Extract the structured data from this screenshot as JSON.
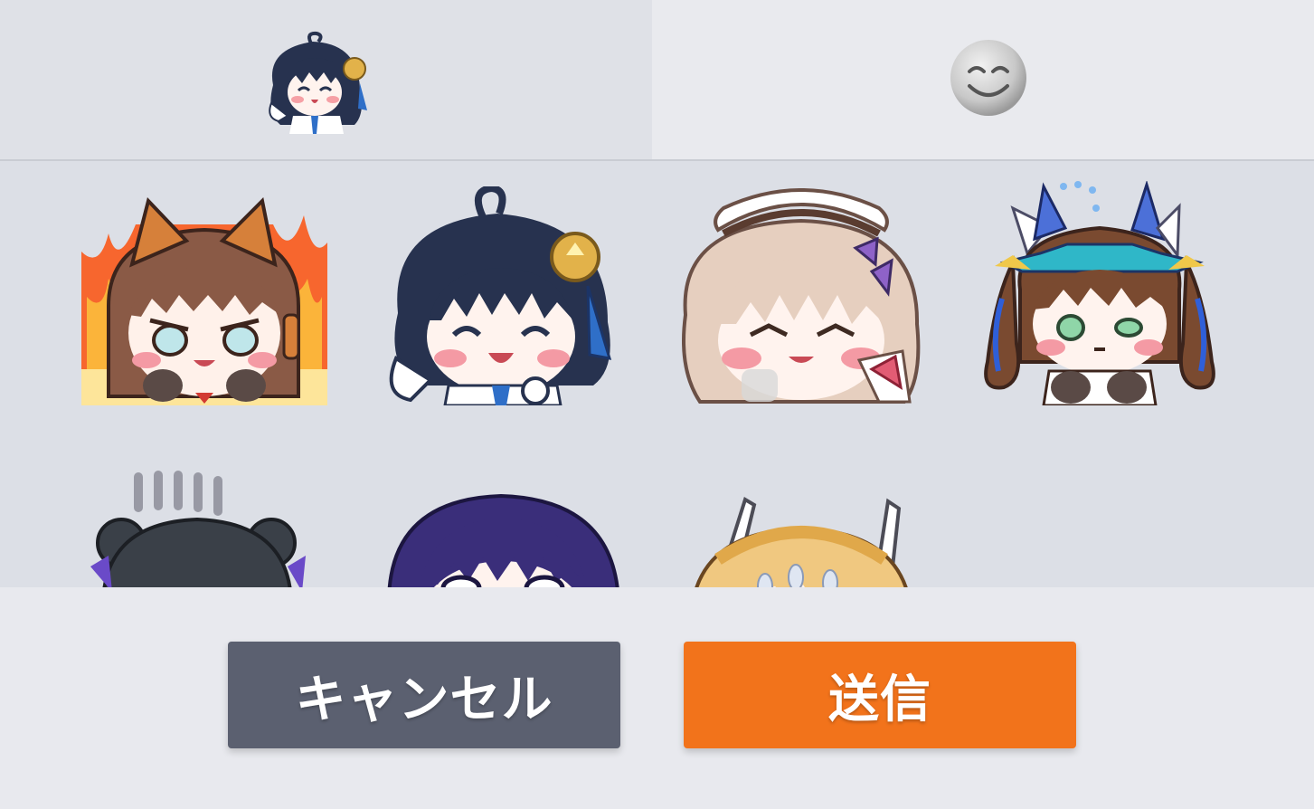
{
  "tabs": [
    {
      "id": "stickers",
      "icon": "sticker-character-icon",
      "selected": true
    },
    {
      "id": "emoji",
      "icon": "smiling-face-icon",
      "selected": false
    }
  ],
  "stickers": [
    {
      "icon": "sticker-cat-ears-flames"
    },
    {
      "icon": "sticker-dark-hair-cheering"
    },
    {
      "icon": "sticker-maid-blonde-laughing"
    },
    {
      "icon": "sticker-brown-twintails-crystals"
    },
    {
      "icon": "sticker-dark-buns-gloomy"
    },
    {
      "icon": "sticker-purple-hair-shocked"
    },
    {
      "icon": "sticker-blonde-sweating"
    }
  ],
  "buttons": {
    "cancel_label": "キャンセル",
    "send_label": "送信"
  },
  "colors": {
    "cancel": "#5b6070",
    "send": "#f2731b",
    "tab_selected_bg": "#dfe1e7",
    "grid_bg": "#dcdfe6"
  }
}
